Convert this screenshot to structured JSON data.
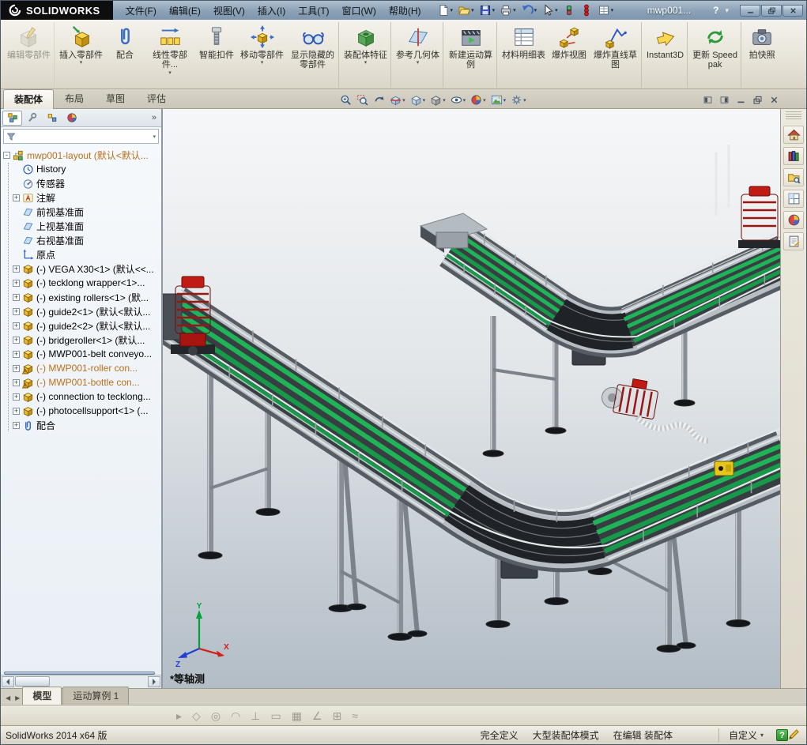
{
  "titlebar": {
    "brand": "SOLIDWORKS",
    "menus": [
      "文件(F)",
      "编辑(E)",
      "视图(V)",
      "插入(I)",
      "工具(T)",
      "窗口(W)",
      "帮助(H)"
    ],
    "doc_name": "mwp001...",
    "help_glyph": "?",
    "collapse_glyph": "▾",
    "tools": [
      {
        "name": "new-document-button",
        "icon": "#ic-new",
        "icon_name": "new-document-icon",
        "arrow": "true"
      },
      {
        "name": "open-button",
        "icon": "#ic-open",
        "icon_name": "open-folder-icon",
        "arrow": "true"
      },
      {
        "name": "save-button",
        "icon": "#ic-save",
        "icon_name": "save-floppy-icon",
        "arrow": "true"
      },
      {
        "name": "print-button",
        "icon": "#ic-print",
        "icon_name": "printer-icon",
        "arrow": "true"
      },
      {
        "name": "undo-button",
        "icon": "#ic-undo",
        "icon_name": "undo-arrow-icon",
        "arrow": "true"
      },
      {
        "name": "select-button",
        "icon": "#ic-select",
        "icon_name": "select-cursor-icon",
        "arrow": "true"
      },
      {
        "name": "rebuild-button",
        "icon": "#ic-rebuild",
        "icon_name": "rebuild-traffic-icon",
        "arrow": "false"
      },
      {
        "name": "performance-button",
        "icon": "#ic-beads",
        "icon_name": "red-beads-icon",
        "arrow": "false"
      },
      {
        "name": "file-properties-button",
        "icon": "#ic-sheet",
        "icon_name": "properties-sheet-icon",
        "arrow": "true"
      }
    ]
  },
  "ribbon": {
    "buttons": [
      {
        "label": "编辑零部件",
        "name": "edit-component-button",
        "icon": "#ic-edit-comp",
        "icon_name": "edit-component-icon",
        "disabled": "true",
        "arrow": "false",
        "sep": "true"
      },
      {
        "label": "插入零部件",
        "name": "insert-component-button",
        "icon": "#ic-insert-comp",
        "icon_name": "insert-component-icon",
        "disabled": "false",
        "arrow": "true",
        "sep": "false"
      },
      {
        "label": "配合",
        "name": "mate-button",
        "icon": "#ic-mate",
        "icon_name": "mate-paperclip-icon",
        "disabled": "false",
        "arrow": "false",
        "sep": "false"
      },
      {
        "label": "线性零部件...",
        "name": "linear-component-pattern-button",
        "icon": "#ic-linear",
        "icon_name": "linear-pattern-icon",
        "disabled": "false",
        "arrow": "true",
        "sep": "false"
      },
      {
        "label": "智能扣件",
        "name": "smart-fasteners-button",
        "icon": "#ic-fastener",
        "icon_name": "smart-fastener-bolt-icon",
        "disabled": "false",
        "arrow": "false",
        "sep": "false"
      },
      {
        "label": "移动零部件",
        "name": "move-component-button",
        "icon": "#ic-move",
        "icon_name": "move-component-icon",
        "disabled": "false",
        "arrow": "true",
        "sep": "false"
      },
      {
        "label": "显示隐藏的零部件",
        "name": "show-hidden-components-button",
        "icon": "#ic-hideshow",
        "icon_name": "show-hidden-eyeglasses-icon",
        "disabled": "false",
        "arrow": "false",
        "sep": "true"
      },
      {
        "label": "装配体特征",
        "name": "assembly-features-button",
        "icon": "#ic-asmfeat",
        "icon_name": "assembly-feature-icon",
        "disabled": "false",
        "arrow": "true",
        "sep": "true"
      },
      {
        "label": "参考几何体",
        "name": "reference-geometry-button",
        "icon": "#ic-refgeo",
        "icon_name": "reference-geometry-plane-icon",
        "disabled": "false",
        "arrow": "true",
        "sep": "true"
      },
      {
        "label": "新建运动算例",
        "name": "new-motion-study-button",
        "icon": "#ic-motion",
        "icon_name": "motion-study-icon",
        "disabled": "false",
        "arrow": "false",
        "sep": "true"
      },
      {
        "label": "材料明细表",
        "name": "bill-of-materials-button",
        "icon": "#ic-bom",
        "icon_name": "bom-table-icon",
        "disabled": "false",
        "arrow": "false",
        "sep": "false"
      },
      {
        "label": "爆炸视图",
        "name": "exploded-view-button",
        "icon": "#ic-explode",
        "icon_name": "exploded-view-icon",
        "disabled": "false",
        "arrow": "false",
        "sep": "false"
      },
      {
        "label": "爆炸直线草图",
        "name": "explode-line-sketch-button",
        "icon": "#ic-explsketch",
        "icon_name": "explode-line-sketch-icon",
        "disabled": "false",
        "arrow": "false",
        "sep": "true"
      },
      {
        "label": "Instant3D",
        "name": "instant3d-button",
        "icon": "#ic-instant3d",
        "icon_name": "instant3d-arrow-icon",
        "disabled": "false",
        "arrow": "false",
        "sep": "true"
      },
      {
        "label": "更新 Speedpak",
        "name": "update-speedpak-button",
        "icon": "#ic-speedpak",
        "icon_name": "speedpak-refresh-icon",
        "disabled": "false",
        "arrow": "false",
        "sep": "true"
      },
      {
        "label": "拍快照",
        "name": "take-snapshot-button",
        "icon": "#ic-snapshot",
        "icon_name": "snapshot-camera-icon",
        "disabled": "false",
        "arrow": "false",
        "sep": "false"
      }
    ]
  },
  "command_tabs": [
    {
      "label": "装配体",
      "active": "true"
    },
    {
      "label": "布局",
      "active": "false"
    },
    {
      "label": "草图",
      "active": "false"
    },
    {
      "label": "评估",
      "active": "false"
    }
  ],
  "hud": [
    {
      "name": "zoom-to-fit-button",
      "icon": "#ic-zoomfit",
      "icon_name": "zoom-fit-icon",
      "arrow": "false"
    },
    {
      "name": "zoom-to-area-button",
      "icon": "#ic-zoomarea",
      "icon_name": "zoom-area-icon",
      "arrow": "false"
    },
    {
      "name": "previous-view-button",
      "icon": "#ic-prevview",
      "icon_name": "previous-view-icon",
      "arrow": "false"
    },
    {
      "name": "section-view-button",
      "icon": "#ic-section",
      "icon_name": "section-view-icon",
      "arrow": "true"
    },
    {
      "name": "view-orientation-button",
      "icon": "#ic-vieworient",
      "icon_name": "view-cube-icon",
      "arrow": "true"
    },
    {
      "name": "display-style-button",
      "icon": "#ic-displaystyle",
      "icon_name": "display-style-cube-icon",
      "arrow": "true"
    },
    {
      "name": "hide-show-items-button",
      "icon": "#ic-eye",
      "icon_name": "eye-icon",
      "arrow": "true"
    },
    {
      "name": "edit-appearance-button",
      "icon": "#ic-ball",
      "icon_name": "appearance-sphere-icon",
      "arrow": "true"
    },
    {
      "name": "apply-scene-button",
      "icon": "#ic-scene",
      "icon_name": "scene-icon",
      "arrow": "true"
    },
    {
      "name": "view-settings-button",
      "icon": "#ic-viewset",
      "icon_name": "view-settings-icon",
      "arrow": "true"
    }
  ],
  "feature_tree": {
    "panel_chevron": "»",
    "items": [
      {
        "label": "mwp001-layout (默认<默认...",
        "icon": "#ic-asm",
        "icon_name": "assembly-icon",
        "warn": "true",
        "expand": "-",
        "indent": "0"
      },
      {
        "label": "History",
        "icon": "#ic-history",
        "icon_name": "history-icon",
        "warn": "false",
        "expand": "",
        "indent": "1"
      },
      {
        "label": "传感器",
        "icon": "#ic-sensor",
        "icon_name": "sensors-icon",
        "warn": "false",
        "expand": "",
        "indent": "1"
      },
      {
        "label": "注解",
        "icon": "#ic-ann",
        "icon_name": "annotations-icon",
        "warn": "false",
        "expand": "+",
        "indent": "1"
      },
      {
        "label": "前视基准面",
        "icon": "#ic-plane",
        "icon_name": "plane-icon",
        "warn": "false",
        "expand": "",
        "indent": "1"
      },
      {
        "label": "上视基准面",
        "icon": "#ic-plane",
        "icon_name": "plane-icon",
        "warn": "false",
        "expand": "",
        "indent": "1"
      },
      {
        "label": "右视基准面",
        "icon": "#ic-plane",
        "icon_name": "plane-icon",
        "warn": "false",
        "expand": "",
        "indent": "1"
      },
      {
        "label": "原点",
        "icon": "#ic-origin",
        "icon_name": "origin-icon",
        "warn": "false",
        "expand": "",
        "indent": "1"
      },
      {
        "label": "(-) VEGA X30<1> (默认<<...",
        "icon": "#ic-part",
        "icon_name": "part-icon",
        "warn": "false",
        "expand": "+",
        "indent": "1"
      },
      {
        "label": "(-) tecklong wrapper<1>...",
        "icon": "#ic-part",
        "icon_name": "part-icon",
        "warn": "false",
        "expand": "+",
        "indent": "1"
      },
      {
        "label": "(-) existing rollers<1> (默...",
        "icon": "#ic-part",
        "icon_name": "part-icon",
        "warn": "false",
        "expand": "+",
        "indent": "1"
      },
      {
        "label": "(-) guide2<1> (默认<默认...",
        "icon": "#ic-part",
        "icon_name": "part-icon",
        "warn": "false",
        "expand": "+",
        "indent": "1"
      },
      {
        "label": "(-) guide2<2> (默认<默认...",
        "icon": "#ic-part",
        "icon_name": "part-icon",
        "warn": "false",
        "expand": "+",
        "indent": "1"
      },
      {
        "label": "(-) bridgeroller<1> (默认...",
        "icon": "#ic-part",
        "icon_name": "part-icon",
        "warn": "false",
        "expand": "+",
        "indent": "1"
      },
      {
        "label": "(-) MWP001-belt conveyo...",
        "icon": "#ic-part",
        "icon_name": "part-icon",
        "warn": "false",
        "expand": "+",
        "indent": "1"
      },
      {
        "label": "(-) MWP001-roller con...",
        "icon": "#ic-part-warn",
        "icon_name": "part-warning-icon",
        "warn": "true",
        "expand": "+",
        "indent": "1"
      },
      {
        "label": "(-) MWP001-bottle con...",
        "icon": "#ic-part-warn",
        "icon_name": "part-warning-icon",
        "warn": "true",
        "expand": "+",
        "indent": "1"
      },
      {
        "label": "(-) connection to tecklong...",
        "icon": "#ic-part",
        "icon_name": "part-icon",
        "warn": "false",
        "expand": "+",
        "indent": "1"
      },
      {
        "label": "(-) photocellsupport<1> (...",
        "icon": "#ic-part",
        "icon_name": "part-icon",
        "warn": "false",
        "expand": "+",
        "indent": "1"
      },
      {
        "label": "配合",
        "icon": "#ic-mates",
        "icon_name": "mates-icon",
        "warn": "false",
        "expand": "+",
        "indent": "1"
      }
    ]
  },
  "viewport": {
    "view_label": "*等轴测",
    "triad": {
      "x": "X",
      "y": "Y",
      "z": "Z"
    }
  },
  "task_pane": [
    {
      "name": "task-pane-resources-tab",
      "icon": "#ic-home",
      "icon_name": "home-icon"
    },
    {
      "name": "task-pane-design-library-tab",
      "icon": "#ic-designlib",
      "icon_name": "books-icon"
    },
    {
      "name": "task-pane-file-explorer-tab",
      "icon": "#ic-fileexp",
      "icon_name": "folder-search-icon"
    },
    {
      "name": "task-pane-view-palette-tab",
      "icon": "#ic-viewpal",
      "icon_name": "view-palette-grid-icon"
    },
    {
      "name": "task-pane-appearances-tab",
      "icon": "#ic-ball",
      "icon_name": "appearances-sphere-icon"
    },
    {
      "name": "task-pane-custom-properties-tab",
      "icon": "#ic-customprops",
      "icon_name": "document-properties-icon"
    }
  ],
  "bottom_tabs": {
    "nav_left": "◀",
    "nav_right": "▶",
    "tabs": [
      {
        "label": "模型",
        "active": "true"
      },
      {
        "label": "运动算例 1",
        "active": "false"
      }
    ]
  },
  "snap_toolbar": [
    {
      "name": "snap-points-button",
      "glyph": "▸"
    },
    {
      "name": "snap-center-button",
      "glyph": "◇"
    },
    {
      "name": "snap-circle-button",
      "glyph": "◎"
    },
    {
      "name": "snap-tangent-button",
      "glyph": "◠"
    },
    {
      "name": "snap-perpendicular-button",
      "glyph": "⊥"
    },
    {
      "name": "snap-rectangle-button",
      "glyph": "▭"
    },
    {
      "name": "snap-grid-button",
      "glyph": "▦"
    },
    {
      "name": "snap-angle-button",
      "glyph": "∠"
    },
    {
      "name": "snap-table-button",
      "glyph": "⊞"
    },
    {
      "name": "snap-spline-button",
      "glyph": "≈"
    }
  ],
  "status_bar": {
    "app_version": "SolidWorks 2014 x64 版",
    "fully_defined": "完全定义",
    "mode": "大型装配体模式",
    "editing": "在编辑 装配体",
    "custom": "自定义",
    "custom_arrow": "▾",
    "help_glyph": "?"
  }
}
